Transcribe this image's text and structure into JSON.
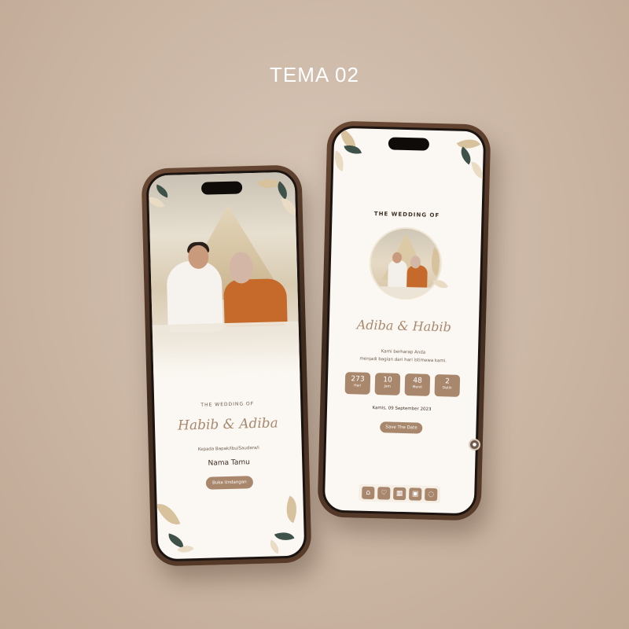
{
  "page": {
    "title": "TEMA 02"
  },
  "cover": {
    "eyebrow": "THE WEDDING OF",
    "couple_names": "Habib & Adiba",
    "recipient_label": "Kepada Bapak/Ibu/Saudara/i",
    "guest_name": "Nama Tamu",
    "open_button": "Buka Undangan"
  },
  "home": {
    "eyebrow": "THE WEDDING OF",
    "couple_names": "Adiba & Habib",
    "message_line1": "Kami berharap Anda",
    "message_line2": "menjadi bagian dari hari istimewa kami.",
    "countdown": [
      {
        "value": "273",
        "label": "Hari"
      },
      {
        "value": "10",
        "label": "Jam"
      },
      {
        "value": "48",
        "label": "Menit"
      },
      {
        "value": "2",
        "label": "Detik"
      }
    ],
    "date": "Kamis, 09 September 2023",
    "save_button": "Save The Date",
    "nav": [
      "home-icon",
      "heart-icon",
      "calendar-icon",
      "gallery-icon",
      "chat-icon"
    ]
  },
  "colors": {
    "accent": "#a8876d",
    "script": "#a8896e",
    "frame": "#4a3324"
  }
}
